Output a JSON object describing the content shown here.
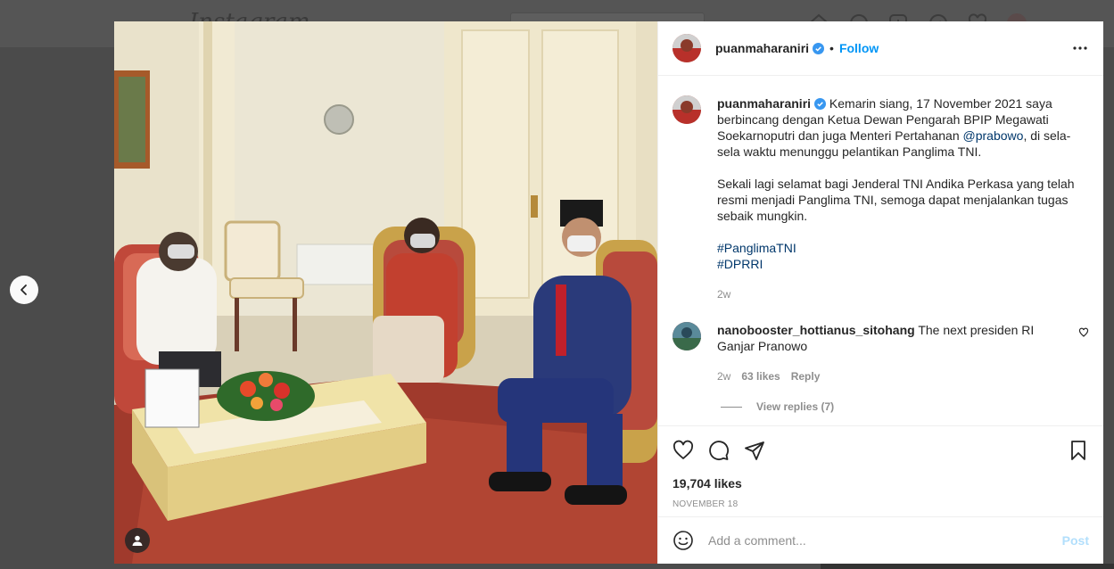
{
  "background": {
    "logo": "Instagram"
  },
  "post": {
    "username": "puanmaharaniri",
    "follow_label": "Follow",
    "separator": "•",
    "caption_parts": {
      "p1": "Kemarin siang, 17 November 2021 saya berbincang dengan Ketua Dewan Pengarah BPIP Megawati Soekarnoputri dan juga Menteri Pertahanan ",
      "mention": "@prabowo",
      "p2": ", di sela-sela waktu menunggu pelantikan Panglima TNI.",
      "p3": "Sekali lagi selamat bagi Jenderal TNI Andika Perkasa yang telah resmi menjadi Panglima TNI, semoga dapat menjalankan tugas sebaik mungkin.",
      "hashtag1": "#PanglimaTNI",
      "hashtag2": "#DPRRI"
    },
    "caption_time": "2w",
    "likes": "19,704 likes",
    "date": "NOVEMBER 18"
  },
  "comments": [
    {
      "username": "nanobooster_hottianus_sitohang",
      "text": "The next presiden RI Ganjar Pranowo",
      "time": "2w",
      "likes": "63 likes",
      "reply_label": "Reply",
      "view_replies": "View replies (7)"
    }
  ],
  "add_comment": {
    "placeholder": "Add a comment...",
    "post_label": "Post"
  },
  "icons": {
    "prev": "chevron-left-icon",
    "like": "heart-icon",
    "comment": "comment-icon",
    "share": "paper-plane-icon",
    "save": "bookmark-icon",
    "more": "more-horizontal-icon",
    "emoji": "smiley-icon",
    "tag": "user-tag-icon",
    "verified": "verified-badge-icon"
  },
  "colors": {
    "accent": "#0095f6",
    "link": "#00376b",
    "muted": "#8e8e8e",
    "post_disabled": "#b2dffc"
  }
}
